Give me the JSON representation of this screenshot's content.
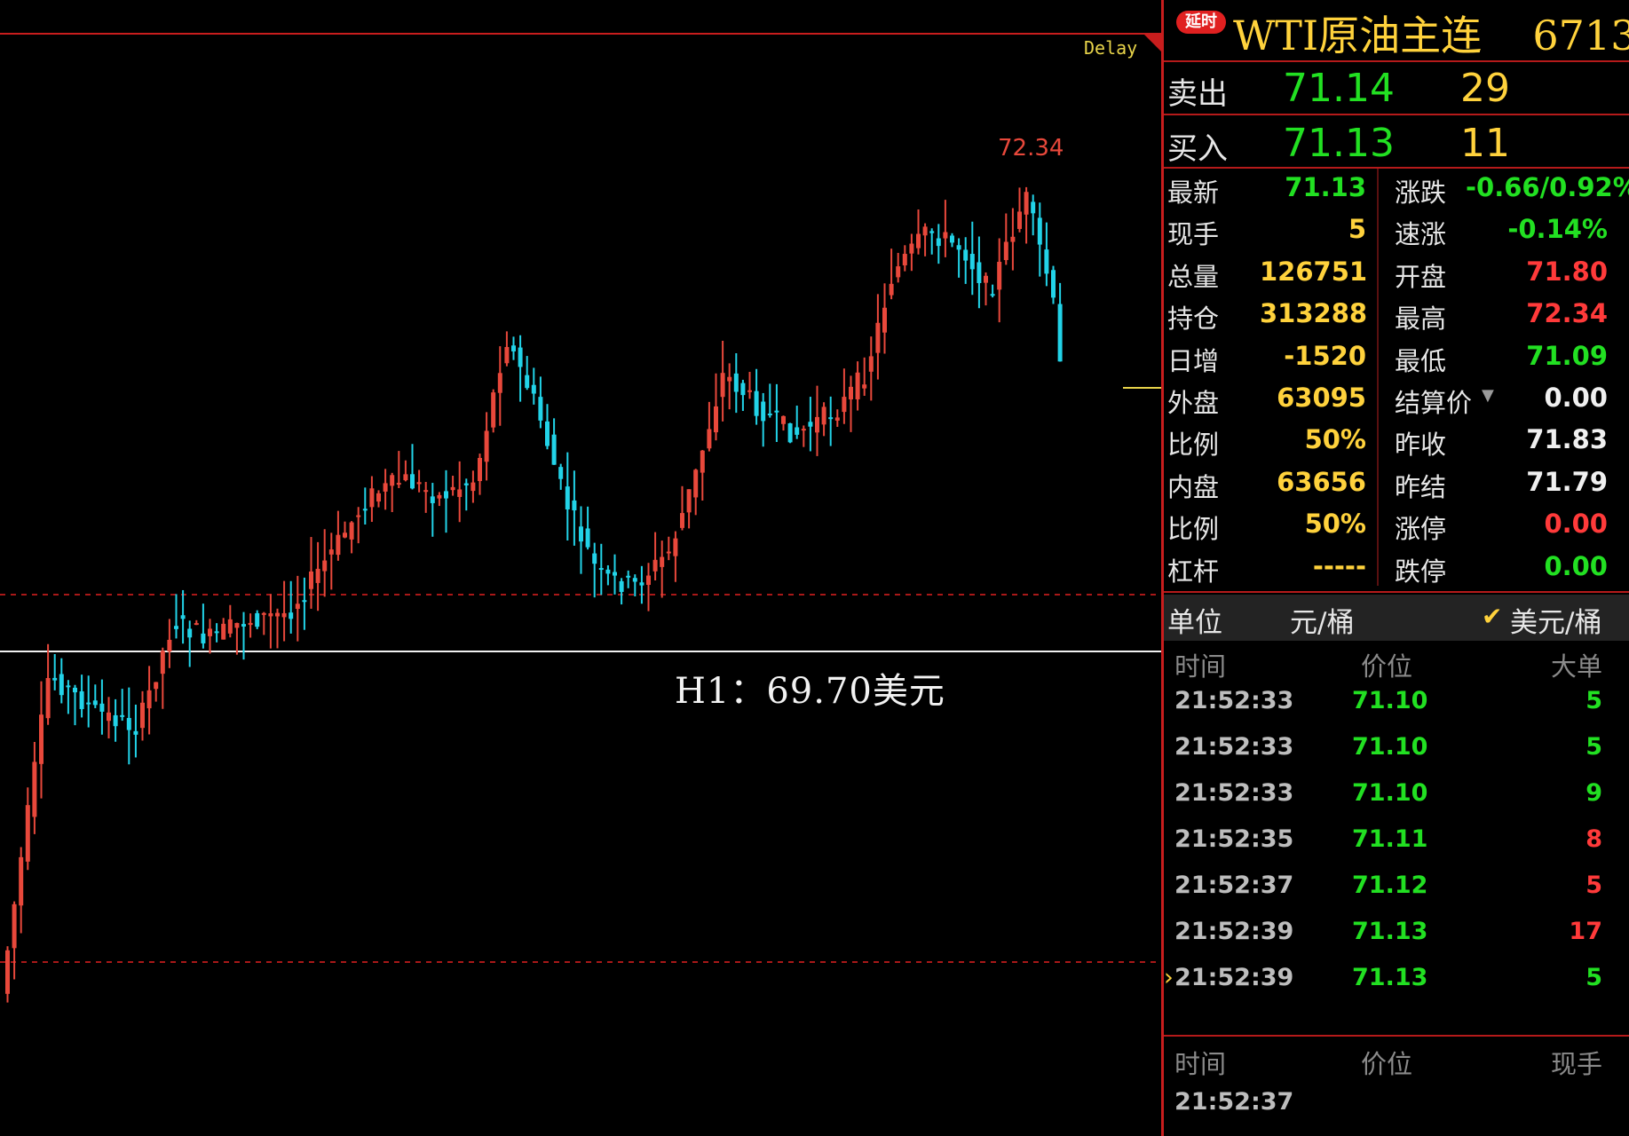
{
  "chart": {
    "delay_label": "Delay",
    "h1_label": "H1：69.70美元",
    "high_label": "72.34",
    "colors": {
      "up": "#e8483b",
      "down": "#22d3e8",
      "guide": "#c81d1d",
      "h1": "#f0f0f0",
      "price_marker": "#e8d44a"
    }
  },
  "quote": {
    "delay_badge": "延时",
    "contract": "WTI原油主连",
    "code": "6713",
    "ask": {
      "label": "卖出",
      "price": "71.14",
      "volume": "29"
    },
    "bid": {
      "label": "买入",
      "price": "71.13",
      "volume": "11"
    },
    "left_stats": [
      {
        "label": "最新",
        "value": "71.13",
        "color": "green"
      },
      {
        "label": "现手",
        "value": "5",
        "color": "yellow"
      },
      {
        "label": "总量",
        "value": "126751",
        "color": "yellow"
      },
      {
        "label": "持仓",
        "value": "313288",
        "color": "yellow"
      },
      {
        "label": "日增",
        "value": "-1520",
        "color": "yellow"
      },
      {
        "label": "外盘",
        "value": "63095",
        "color": "yellow"
      },
      {
        "label": "比例",
        "value": "50%",
        "color": "yellow"
      },
      {
        "label": "内盘",
        "value": "63656",
        "color": "yellow"
      },
      {
        "label": "比例",
        "value": "50%",
        "color": "yellow"
      },
      {
        "label": "杠杆",
        "value": "-----",
        "color": "yellow"
      }
    ],
    "right_stats": [
      {
        "label": "涨跌",
        "value": "-0.66/0.92%",
        "color": "green"
      },
      {
        "label": "速涨",
        "value": "-0.14%",
        "color": "green"
      },
      {
        "label": "开盘",
        "value": "71.80",
        "color": "red"
      },
      {
        "label": "最高",
        "value": "72.34",
        "color": "red"
      },
      {
        "label": "最低",
        "value": "71.09",
        "color": "green"
      },
      {
        "label": "结算价",
        "value": "0.00",
        "color": "white"
      },
      {
        "label": "昨收",
        "value": "71.83",
        "color": "white"
      },
      {
        "label": "昨结",
        "value": "71.79",
        "color": "white"
      },
      {
        "label": "涨停",
        "value": "0.00",
        "color": "red"
      },
      {
        "label": "跌停",
        "value": "0.00",
        "color": "green"
      }
    ],
    "unit": {
      "label": "单位",
      "cny": "元/桶",
      "usd": "美元/桶",
      "selected": "usd"
    },
    "ticks_header": {
      "time": "时间",
      "price": "价位",
      "size": "大单"
    },
    "ticks": [
      {
        "time": "21:52:33",
        "price": "71.10",
        "size": "5",
        "dir": "green"
      },
      {
        "time": "21:52:33",
        "price": "71.10",
        "size": "5",
        "dir": "green"
      },
      {
        "time": "21:52:33",
        "price": "71.10",
        "size": "9",
        "dir": "green"
      },
      {
        "time": "21:52:35",
        "price": "71.11",
        "size": "8",
        "dir": "red"
      },
      {
        "time": "21:52:37",
        "price": "71.12",
        "size": "5",
        "dir": "red"
      },
      {
        "time": "21:52:39",
        "price": "71.13",
        "size": "17",
        "dir": "red"
      },
      {
        "time": "21:52:39",
        "price": "71.13",
        "size": "5",
        "dir": "green"
      }
    ],
    "trades_header": {
      "time": "时间",
      "price": "价位",
      "size": "现手"
    },
    "trades": [
      {
        "time": "21:52:37"
      }
    ]
  }
}
